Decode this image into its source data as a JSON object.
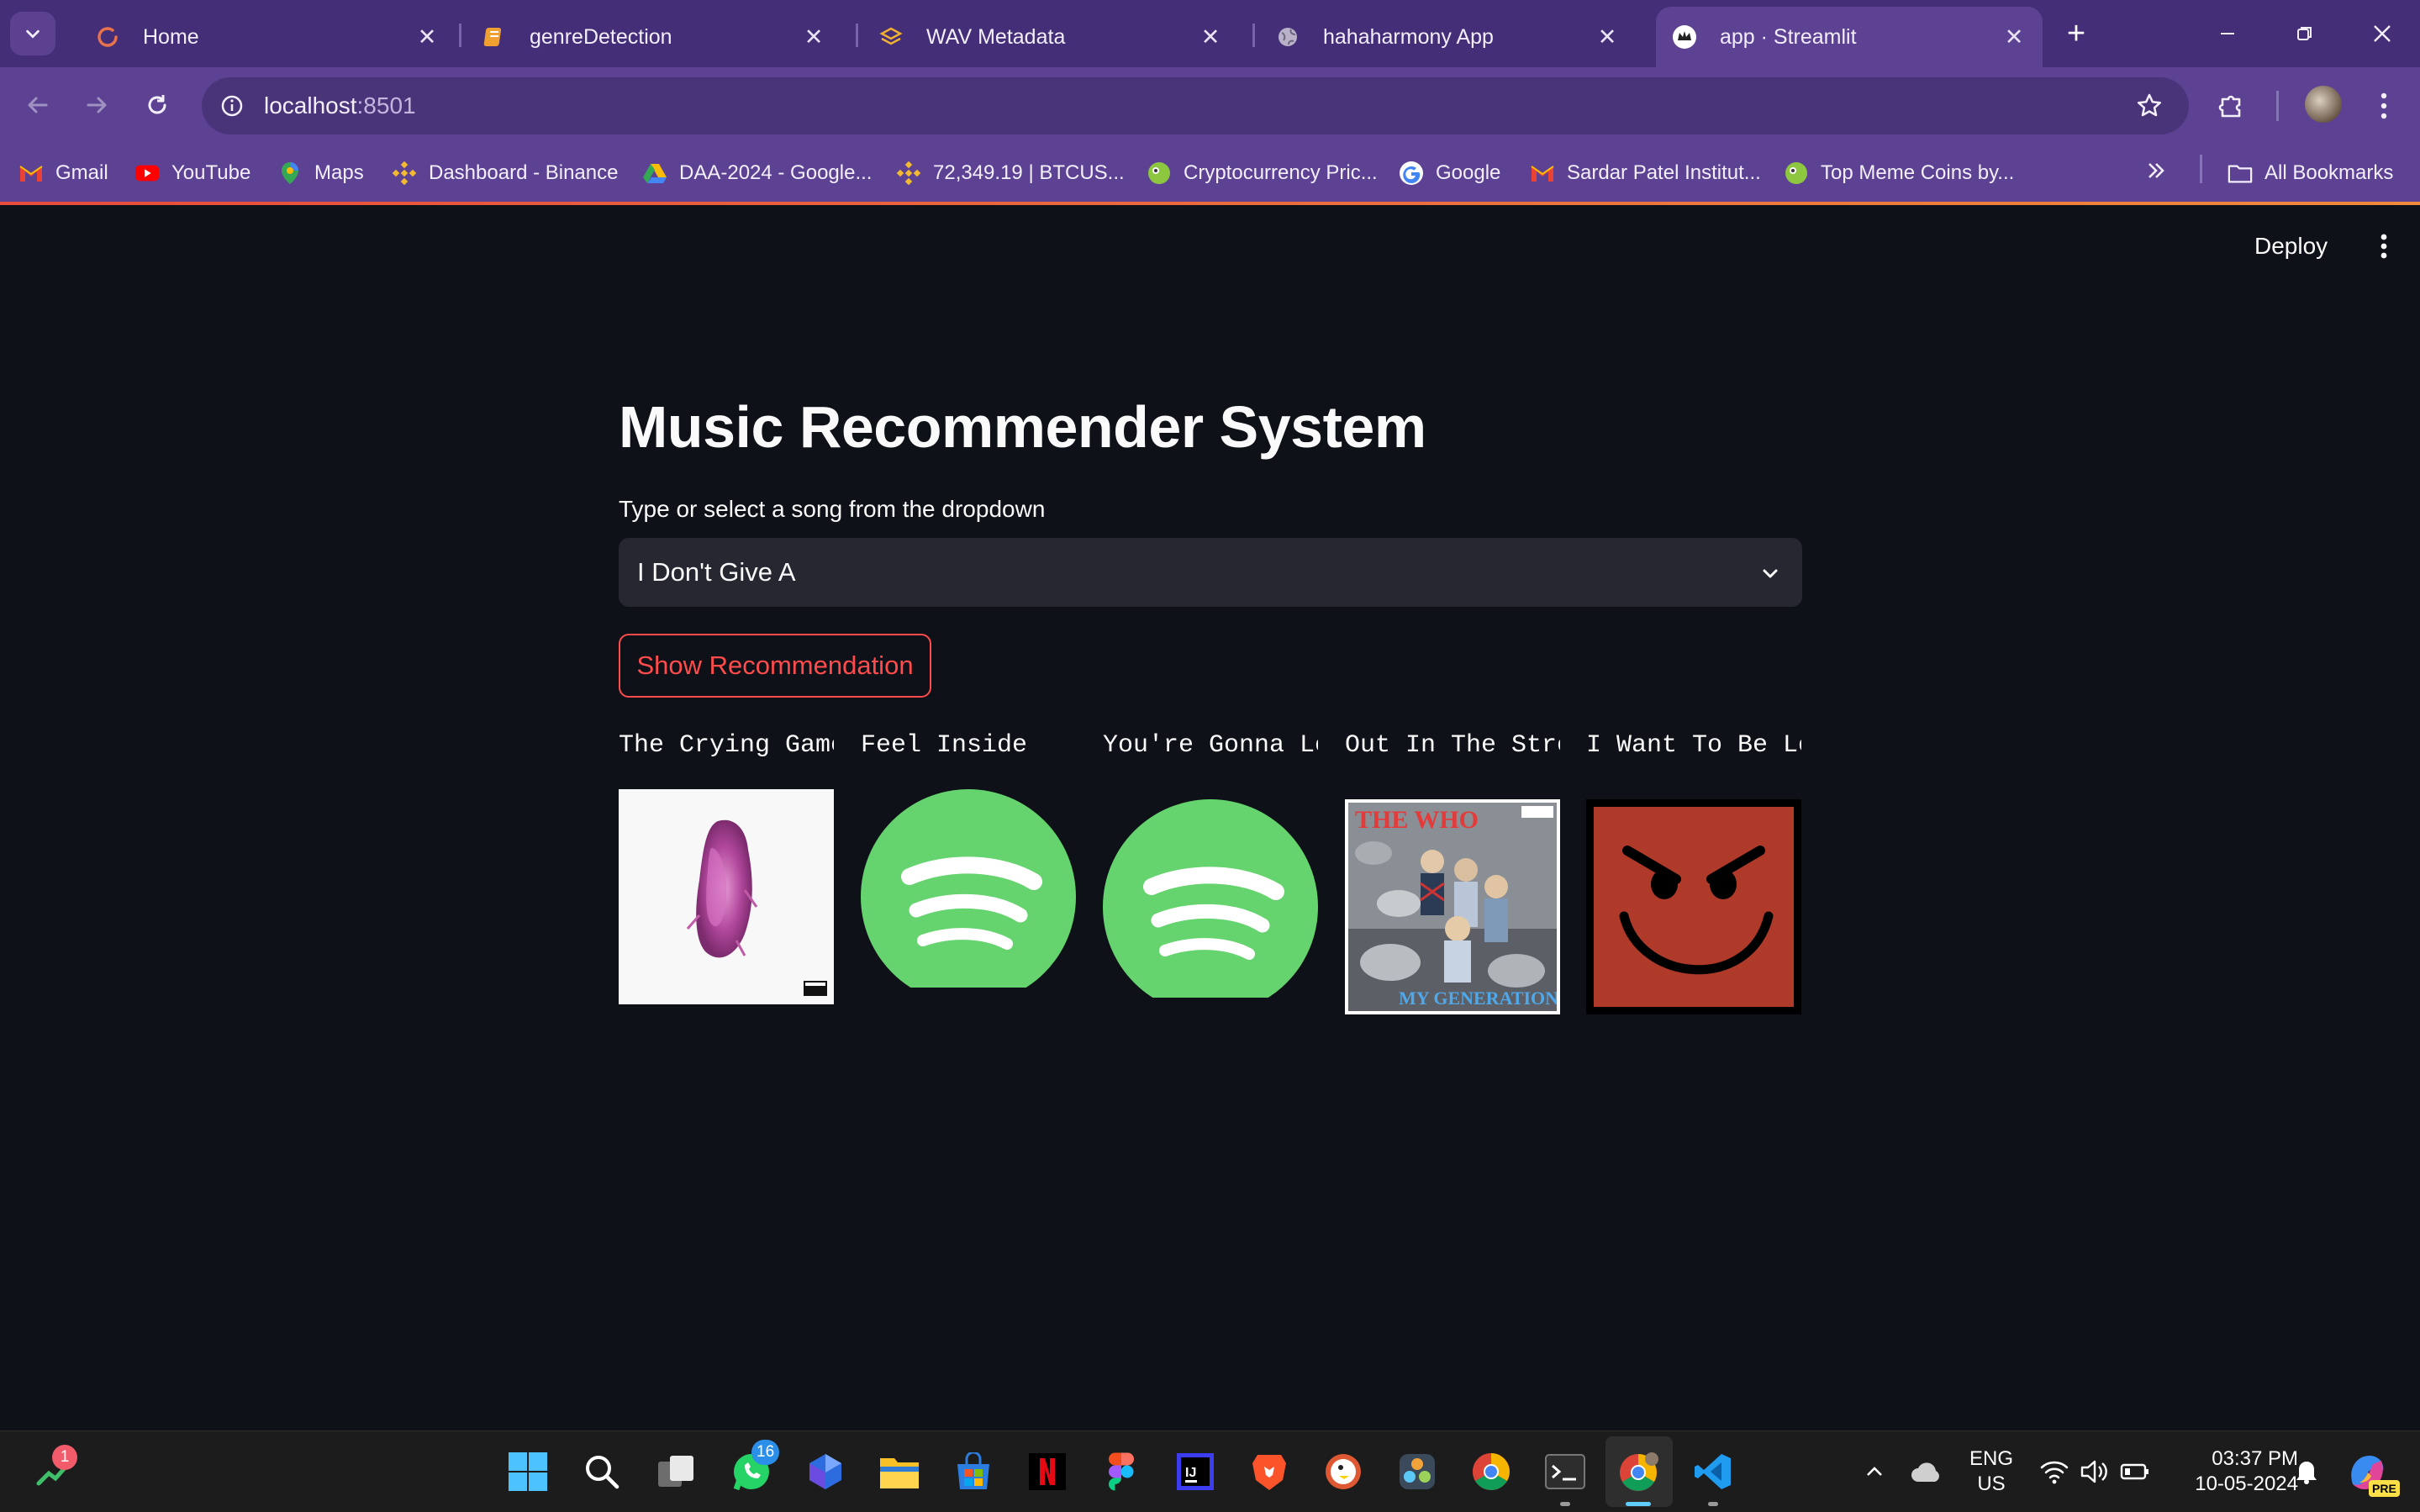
{
  "browser": {
    "tabs": [
      {
        "title": "Home",
        "icon": "loading-spinner-icon",
        "active": false
      },
      {
        "title": "genreDetection",
        "icon": "notebook-icon",
        "active": false
      },
      {
        "title": "WAV Metadata",
        "icon": "layers-icon",
        "active": false
      },
      {
        "title": "hahaharmony App",
        "icon": "globe-icon",
        "active": false
      },
      {
        "title": "app · Streamlit",
        "icon": "streamlit-crown-icon",
        "active": true
      }
    ],
    "url_host": "localhost",
    "url_port": ":8501",
    "bookmarks": [
      {
        "label": "Gmail",
        "icon": "gmail-icon"
      },
      {
        "label": "YouTube",
        "icon": "youtube-icon"
      },
      {
        "label": "Maps",
        "icon": "maps-icon"
      },
      {
        "label": "Dashboard - Binance",
        "icon": "binance-icon"
      },
      {
        "label": "DAA-2024 - Google...",
        "icon": "google-drive-icon"
      },
      {
        "label": "72,349.19 | BTCUS...",
        "icon": "binance-icon"
      },
      {
        "label": "Cryptocurrency Pric...",
        "icon": "coingecko-icon"
      },
      {
        "label": "Google",
        "icon": "google-icon"
      },
      {
        "label": "Sardar Patel Institut...",
        "icon": "gmail-icon"
      },
      {
        "label": "Top Meme Coins by...",
        "icon": "coingecko-icon"
      }
    ],
    "all_bookmarks": "All Bookmarks"
  },
  "app": {
    "deploy_label": "Deploy",
    "title": "Music Recommender System",
    "select_label": "Type or select a song from the dropdown",
    "selected_song": "I Don't Give A",
    "button_label": "Show Recommendation",
    "recommendations": [
      {
        "title": "The Crying Game",
        "art": "pink-album-cover"
      },
      {
        "title": "Feel Inside",
        "art": "spotify-logo"
      },
      {
        "title": "You're Gonna Lo",
        "art": "spotify-logo"
      },
      {
        "title": "Out In The Stre",
        "art": "the-who-my-generation-cover",
        "cover_text_top": "THE WHO",
        "cover_text_bottom": "MY GENERATION"
      },
      {
        "title": "I Want To Be Lo",
        "art": "devil-smiley-cover"
      }
    ]
  },
  "taskbar": {
    "notification_badge": "1",
    "whatsapp_badge": "16",
    "lang_top": "ENG",
    "lang_bottom": "US",
    "time": "03:37 PM",
    "date": "10-05-2024",
    "copilot_badge": "PRE"
  },
  "colors": {
    "tabstrip": "#442e78",
    "toolbar": "#5d4294",
    "page_bg": "#0e1117",
    "select_bg": "#262730",
    "primary": "#ff4b4b",
    "spotify_green": "#65d36e"
  }
}
